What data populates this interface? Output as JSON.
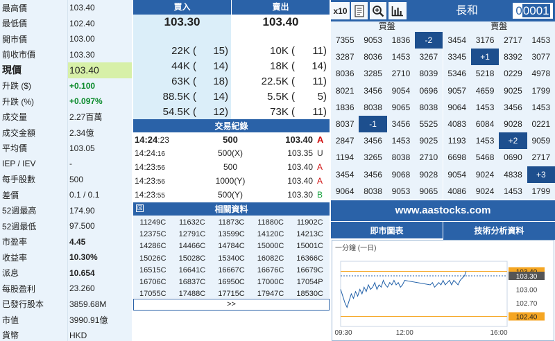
{
  "quote": {
    "rows": [
      {
        "label": "最高價",
        "value": "103.40"
      },
      {
        "label": "最低價",
        "value": "102.40"
      },
      {
        "label": "開市價",
        "value": "103.00"
      },
      {
        "label": "前收市價",
        "value": "103.30"
      },
      {
        "label": "現價",
        "value": "103.40"
      },
      {
        "label": "升跌 ($)",
        "value": "+0.100"
      },
      {
        "label": "升跌 (%)",
        "value": "+0.097%"
      },
      {
        "label": "成交量",
        "value": "2.27百萬"
      },
      {
        "label": "成交金額",
        "value": "2.34億"
      },
      {
        "label": "平均價",
        "value": "103.05"
      },
      {
        "label": "IEP / IEV",
        "value": "-"
      },
      {
        "label": "每手股數",
        "value": "500"
      },
      {
        "label": "差價",
        "value": "0.1 / 0.1"
      },
      {
        "label": "52週最高",
        "value": "174.90"
      },
      {
        "label": "52週最低",
        "value": "97.500"
      },
      {
        "label": "市盈率",
        "value": "4.45"
      },
      {
        "label": "收益率",
        "value": "10.30%"
      },
      {
        "label": "派息",
        "value": "10.654"
      },
      {
        "label": "每股盈利",
        "value": "23.260"
      },
      {
        "label": "已發行股本",
        "value": "3859.68M"
      },
      {
        "label": "市值",
        "value": "3990.91億"
      },
      {
        "label": "貨幣",
        "value": "HKD"
      }
    ]
  },
  "bidask": {
    "bid_label": "買入",
    "ask_label": "賣出",
    "bid_price": "103.30",
    "ask_price": "103.40",
    "queue": [
      {
        "bid_vol": "22K (",
        "bid_cnt": "15)",
        "ask_vol": "10K (",
        "ask_cnt": "11)"
      },
      {
        "bid_vol": "44K (",
        "bid_cnt": "14)",
        "ask_vol": "18K (",
        "ask_cnt": "14)"
      },
      {
        "bid_vol": "63K (",
        "bid_cnt": "18)",
        "ask_vol": "22.5K (",
        "ask_cnt": "11)"
      },
      {
        "bid_vol": "88.5K (",
        "bid_cnt": "14)",
        "ask_vol": "5.5K (",
        "ask_cnt": "5)"
      },
      {
        "bid_vol": "54.5K (",
        "bid_cnt": "12)",
        "ask_vol": "73K (",
        "ask_cnt": "11)"
      }
    ]
  },
  "trades": {
    "title": "交易紀錄",
    "rows": [
      {
        "time_main": "14:24",
        "time_sec": ":23",
        "vol": "500",
        "price": "103.40",
        "flag": "A"
      },
      {
        "time_main": "14:24",
        "time_sec": ":16",
        "vol": "500(X)",
        "price": "103.35",
        "flag": "U"
      },
      {
        "time_main": "14:23",
        "time_sec": ":56",
        "vol": "500",
        "price": "103.40",
        "flag": "A"
      },
      {
        "time_main": "14:23",
        "time_sec": ":56",
        "vol": "1000(Y)",
        "price": "103.40",
        "flag": "A"
      },
      {
        "time_main": "14:23",
        "time_sec": ":55",
        "vol": "500(Y)",
        "price": "103.30",
        "flag": "B"
      }
    ]
  },
  "related": {
    "box_glyph": "☒",
    "title": "相關資料",
    "rows": [
      [
        "11249C",
        "11632C",
        "11873C",
        "11880C",
        "11902C"
      ],
      [
        "12375C",
        "12791C",
        "13599C",
        "14120C",
        "14213C"
      ],
      [
        "14286C",
        "14466C",
        "14784C",
        "15000C",
        "15001C"
      ],
      [
        "15026C",
        "15028C",
        "15340C",
        "16082C",
        "16366C"
      ],
      [
        "16515C",
        "16641C",
        "16667C",
        "16676C",
        "16679C"
      ],
      [
        "16706C",
        "16837C",
        "16950C",
        "17000C",
        "17054P"
      ],
      [
        "17055C",
        "17488C",
        "17715C",
        "17947C",
        "18530C"
      ]
    ],
    "more_label": ">>"
  },
  "toolbar": {
    "x10_label": "x10",
    "stock_name": "長和",
    "stock_code_prefix": "0",
    "stock_code_selected": "0001"
  },
  "broker": {
    "bid_label": "買盤",
    "ask_label": "賣盤",
    "rows": [
      [
        "7355",
        "9053",
        "1836",
        "-2",
        "3454",
        "3176",
        "2717",
        "1453"
      ],
      [
        "3287",
        "8036",
        "1453",
        "3267",
        "3345",
        "+1",
        "8392",
        "3077"
      ],
      [
        "8036",
        "3285",
        "2710",
        "8039",
        "5346",
        "5218",
        "0229",
        "4978"
      ],
      [
        "8021",
        "3456",
        "9054",
        "0696",
        "9057",
        "4659",
        "9025",
        "1799"
      ],
      [
        "1836",
        "8038",
        "9065",
        "8038",
        "9064",
        "1453",
        "3456",
        "1453"
      ],
      [
        "8037",
        "-1",
        "3456",
        "5525",
        "4083",
        "6084",
        "9028",
        "0221"
      ],
      [
        "2847",
        "3456",
        "1453",
        "9025",
        "1193",
        "1453",
        "+2",
        "9059"
      ],
      [
        "1194",
        "3265",
        "8038",
        "2710",
        "6698",
        "5468",
        "0690",
        "2717"
      ],
      [
        "3454",
        "3456",
        "9068",
        "9028",
        "9054",
        "9024",
        "4838",
        "+3"
      ],
      [
        "9064",
        "8038",
        "9053",
        "9065",
        "4086",
        "9024",
        "1453",
        "1799"
      ]
    ]
  },
  "banner": {
    "text": "www.aastocks.com"
  },
  "chart_tabs": {
    "realtime_label": "即市圖表",
    "technical_label": "技術分析資料"
  },
  "chart_data": {
    "type": "line",
    "subtitle": "一分鐘 (一日)",
    "x_ticks": [
      "09:30",
      "12:00",
      "16:00"
    ],
    "y_ticks": [
      "103.40",
      "103.30",
      "103.00",
      "102.70",
      "102.40"
    ],
    "high_tag": "103.40",
    "prev_close_tag": "103.30",
    "low_tag": "102.40",
    "ylim": [
      102.3,
      103.5
    ],
    "colors": {
      "line": "#1f5fa8",
      "tag": "#f5a623",
      "prev_close": "#2a62a8"
    },
    "x": [
      "09:30",
      "09:35",
      "09:40",
      "09:45",
      "09:50",
      "09:55",
      "10:00",
      "10:05",
      "10:10",
      "10:15",
      "10:20",
      "10:25",
      "10:30",
      "10:35",
      "10:40",
      "10:45",
      "10:50",
      "10:55",
      "11:00",
      "11:05",
      "11:10",
      "11:15",
      "11:20",
      "11:25",
      "11:30",
      "11:35",
      "11:40",
      "11:45",
      "11:50",
      "11:55",
      "12:00",
      "13:00",
      "13:05",
      "13:10",
      "13:15",
      "13:20",
      "13:25",
      "13:30",
      "13:35",
      "13:40",
      "13:45",
      "13:50",
      "13:55",
      "14:00",
      "14:05",
      "14:10",
      "14:15",
      "14:20",
      "14:24"
    ],
    "values": [
      103.0,
      102.85,
      102.7,
      102.6,
      102.75,
      102.9,
      102.8,
      102.95,
      102.85,
      103.0,
      102.9,
      103.05,
      102.95,
      103.1,
      103.0,
      103.05,
      103.15,
      103.0,
      103.1,
      103.05,
      103.2,
      103.1,
      103.05,
      103.15,
      103.1,
      103.2,
      103.1,
      103.15,
      103.05,
      103.1,
      103.2,
      103.1,
      103.15,
      103.05,
      103.1,
      103.15,
      103.1,
      103.2,
      103.1,
      103.15,
      103.2,
      103.1,
      103.2,
      103.15,
      103.1,
      103.2,
      103.25,
      103.3,
      103.4
    ]
  }
}
